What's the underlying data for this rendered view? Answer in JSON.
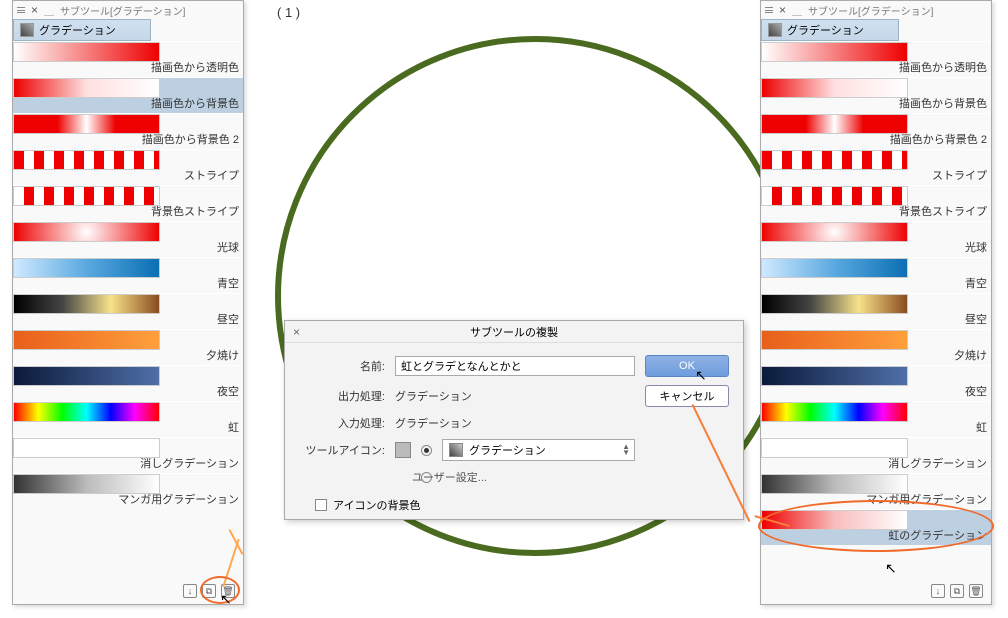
{
  "step_marker": "( 1 )",
  "panelTitle": "サブツール[グラデーション]",
  "tabLabel": "グラデーション",
  "gradientsLeft": [
    {
      "label": "描画色から透明色"
    },
    {
      "label": "描画色から背景色"
    },
    {
      "label": "描画色から背景色 2"
    },
    {
      "label": "ストライプ"
    },
    {
      "label": "背景色ストライプ"
    },
    {
      "label": "光球"
    },
    {
      "label": "青空"
    },
    {
      "label": "昼空"
    },
    {
      "label": "夕焼け"
    },
    {
      "label": "夜空"
    },
    {
      "label": "虹"
    },
    {
      "label": "消しグラデーション"
    },
    {
      "label": "マンガ用グラデーション"
    }
  ],
  "gradientsRight": [
    {
      "label": "描画色から透明色"
    },
    {
      "label": "描画色から背景色"
    },
    {
      "label": "描画色から背景色 2"
    },
    {
      "label": "ストライプ"
    },
    {
      "label": "背景色ストライプ"
    },
    {
      "label": "光球"
    },
    {
      "label": "青空"
    },
    {
      "label": "昼空"
    },
    {
      "label": "夕焼け"
    },
    {
      "label": "夜空"
    },
    {
      "label": "虹"
    },
    {
      "label": "消しグラデーション"
    },
    {
      "label": "マンガ用グラデーション"
    },
    {
      "label": "虹のグラデーション"
    }
  ],
  "dialog": {
    "title": "サブツールの複製",
    "nameLabel": "名前:",
    "nameValue": "虹とグラデとなんとかと",
    "outputLabel": "出力処理:",
    "outputValue": "グラデーション",
    "inputLabel": "入力処理:",
    "inputValue": "グラデーション",
    "toolIconLabel": "ツールアイコン:",
    "iconSelectLabel": "グラデーション",
    "userSetting": "ユーザー設定...",
    "iconBgLabel": "アイコンの背景色",
    "ok": "OK",
    "cancel": "キャンセル"
  }
}
